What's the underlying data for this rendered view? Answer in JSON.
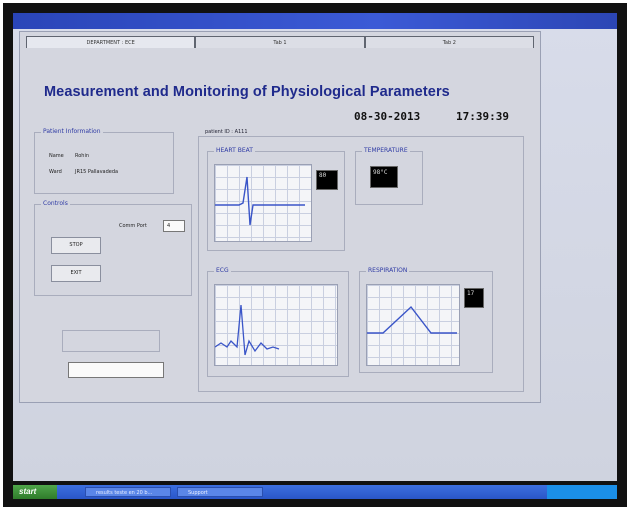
{
  "tabs": [
    "DEPARTMENT : ECE",
    "Tab 1",
    "Tab 2"
  ],
  "page_title": "Measurement and Monitoring of Physiological Parameters",
  "date": "08-30-2013",
  "time": "17:39:39",
  "patient_info": {
    "group_label": "Patient Information",
    "name_label": "Name",
    "name_value": "Rohin",
    "ward_label": "Ward",
    "ward_value": "JR15 Pallavadeda"
  },
  "controls": {
    "group_label": "Controls",
    "comm_port_label": "Comm Port",
    "comm_port_value": "4",
    "stop_label": "STOP",
    "exit_label": "EXIT"
  },
  "patient_id_label": "patient ID : A111",
  "panels": {
    "heart_beat": {
      "label": "HEART BEAT",
      "readout": "80"
    },
    "temperature": {
      "label": "TEMPERATURE",
      "readout": "98°C"
    },
    "ecg": {
      "label": "ECG"
    },
    "respiration": {
      "label": "RESPIRATION",
      "readout": "17"
    }
  },
  "taskbar": {
    "start_label": "start",
    "task1_label": "results teste en 20 b...",
    "task2_label": "Support"
  }
}
